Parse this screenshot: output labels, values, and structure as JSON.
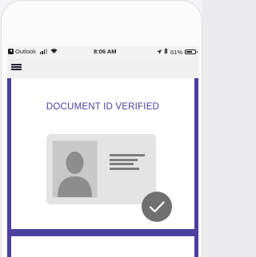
{
  "status_bar": {
    "back_app": "Outlook",
    "time": "8:06 AM",
    "battery": "61%"
  },
  "main": {
    "card_title": "DOCUMENT ID VERIFIED"
  },
  "colors": {
    "accent": "#4b3f9f",
    "check_circle": "#707070"
  },
  "icons": {
    "menu": "hamburger-menu-icon",
    "portrait": "person-silhouette-icon",
    "verified": "checkmark-circle-icon"
  }
}
